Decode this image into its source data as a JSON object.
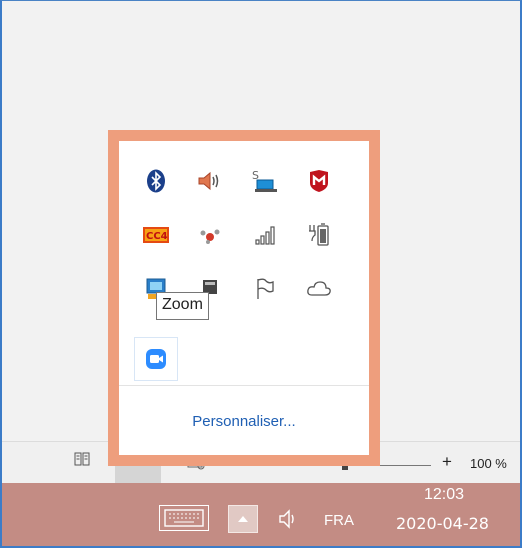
{
  "tray_popup": {
    "icons": [
      {
        "name": "bluetooth-icon"
      },
      {
        "name": "speaker-icon"
      },
      {
        "name": "skype-business-icon"
      },
      {
        "name": "mcafee-icon"
      },
      {
        "name": "cc4-icon"
      },
      {
        "name": "network-device-icon"
      },
      {
        "name": "signal-bars-icon"
      },
      {
        "name": "battery-icon"
      },
      {
        "name": "monitor-app-icon"
      },
      {
        "name": "window-app-icon"
      },
      {
        "name": "flag-icon"
      },
      {
        "name": "cloud-icon"
      },
      {
        "name": "zoom-icon"
      }
    ],
    "customize_label": "Personnaliser...",
    "tooltip": "Zoom"
  },
  "statusbar": {
    "zoom_plus": "+",
    "zoom_percent": "100 %"
  },
  "taskbar": {
    "language": "FRA",
    "time": "12:03",
    "date": "2020-04-28"
  },
  "colors": {
    "popup_border": "#ee9e7d",
    "taskbar": "#c38c84",
    "link": "#1f5fb3",
    "zoom_blue": "#2d8cff"
  }
}
